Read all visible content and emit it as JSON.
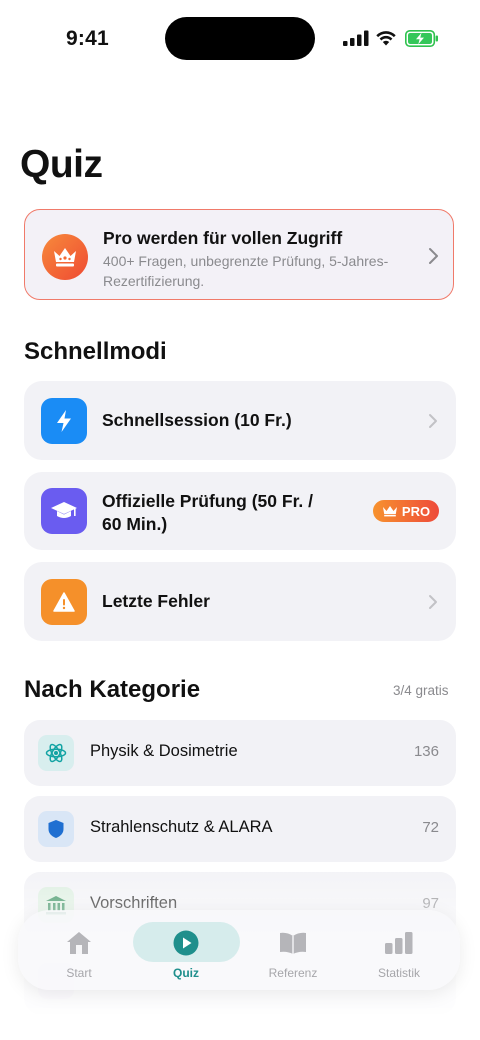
{
  "status_bar": {
    "time": "9:41"
  },
  "page": {
    "title": "Quiz"
  },
  "pro_banner": {
    "title": "Pro werden für vollen Zugriff",
    "subtitle": "400+ Fragen, unbegrenzte Prüfung, 5-Jahres-Rezertifizierung."
  },
  "quick_modes": {
    "heading": "Schnellmodi",
    "items": [
      {
        "label": "Schnellsession (10 Fr.)",
        "icon": "lightning-icon",
        "color": "#1a8cf5"
      },
      {
        "label": "Offizielle Prüfung (50 Fr. / 60 Min.)",
        "label_line1": "Offizielle Prüfung (50 Fr. /",
        "label_line2": "60 Min.)",
        "icon": "graduation-cap-icon",
        "color": "#6a5cf0",
        "badge": "PRO"
      },
      {
        "label": "Letzte Fehler",
        "icon": "warning-icon",
        "color": "#f5902a"
      }
    ]
  },
  "categories": {
    "heading": "Nach Kategorie",
    "free_count": "3/4 gratis",
    "items": [
      {
        "label": "Physik & Dosimetrie",
        "count": "136",
        "icon": "atom-icon",
        "color": "#12a3a3"
      },
      {
        "label": "Strahlenschutz & ALARA",
        "count": "72",
        "icon": "shield-icon",
        "color": "#1f6fd1"
      },
      {
        "label": "Vorschriften",
        "count": "97",
        "icon": "building-icon",
        "color": "#2e8b57"
      }
    ]
  },
  "tab_bar": {
    "tabs": [
      {
        "label": "Start",
        "icon": "house-icon"
      },
      {
        "label": "Quiz",
        "icon": "play-icon",
        "active": true
      },
      {
        "label": "Referenz",
        "icon": "book-icon"
      },
      {
        "label": "Statistik",
        "icon": "bar-chart-icon"
      }
    ],
    "accent": "#1f8f8c"
  }
}
